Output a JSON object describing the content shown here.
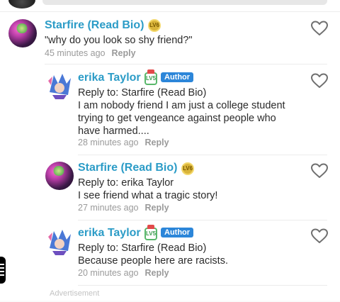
{
  "comments": [
    {
      "author": "Starfire (Read Bio)",
      "level_badge": "LV6",
      "is_author": false,
      "text": "\"why do you look so shy friend?\"",
      "time": "45 minutes ago",
      "reply_label": "Reply"
    },
    {
      "author": "erika Taylor",
      "level_badge": "LV5",
      "is_author": true,
      "author_badge": "Author",
      "reply_to": "Reply to: Starfire (Read Bio)",
      "text": "I am nobody friend I am just a college student\ntrying to get vengeance against people who\nhave harmed....",
      "time": "28 minutes ago",
      "reply_label": "Reply"
    },
    {
      "author": "Starfire (Read Bio)",
      "level_badge": "LV6",
      "is_author": false,
      "reply_to": "Reply to: erika Taylor",
      "text": "I see friend what a tragic story!",
      "time": "27 minutes ago",
      "reply_label": "Reply"
    },
    {
      "author": "erika Taylor",
      "level_badge": "LV5",
      "is_author": true,
      "author_badge": "Author",
      "reply_to": "Reply to: Starfire (Read Bio)",
      "text": "Because people here are racists.",
      "time": "20 minutes ago",
      "reply_label": "Reply"
    }
  ],
  "advertisement_label": "Advertisement",
  "colors": {
    "username": "#2c9cc7",
    "author_badge": "#2c86d9",
    "meta_text": "#9a9a9a",
    "divider": "#ececec"
  },
  "icons": [
    "heart-outline-icon",
    "level-badge-icon",
    "menu-icon"
  ]
}
